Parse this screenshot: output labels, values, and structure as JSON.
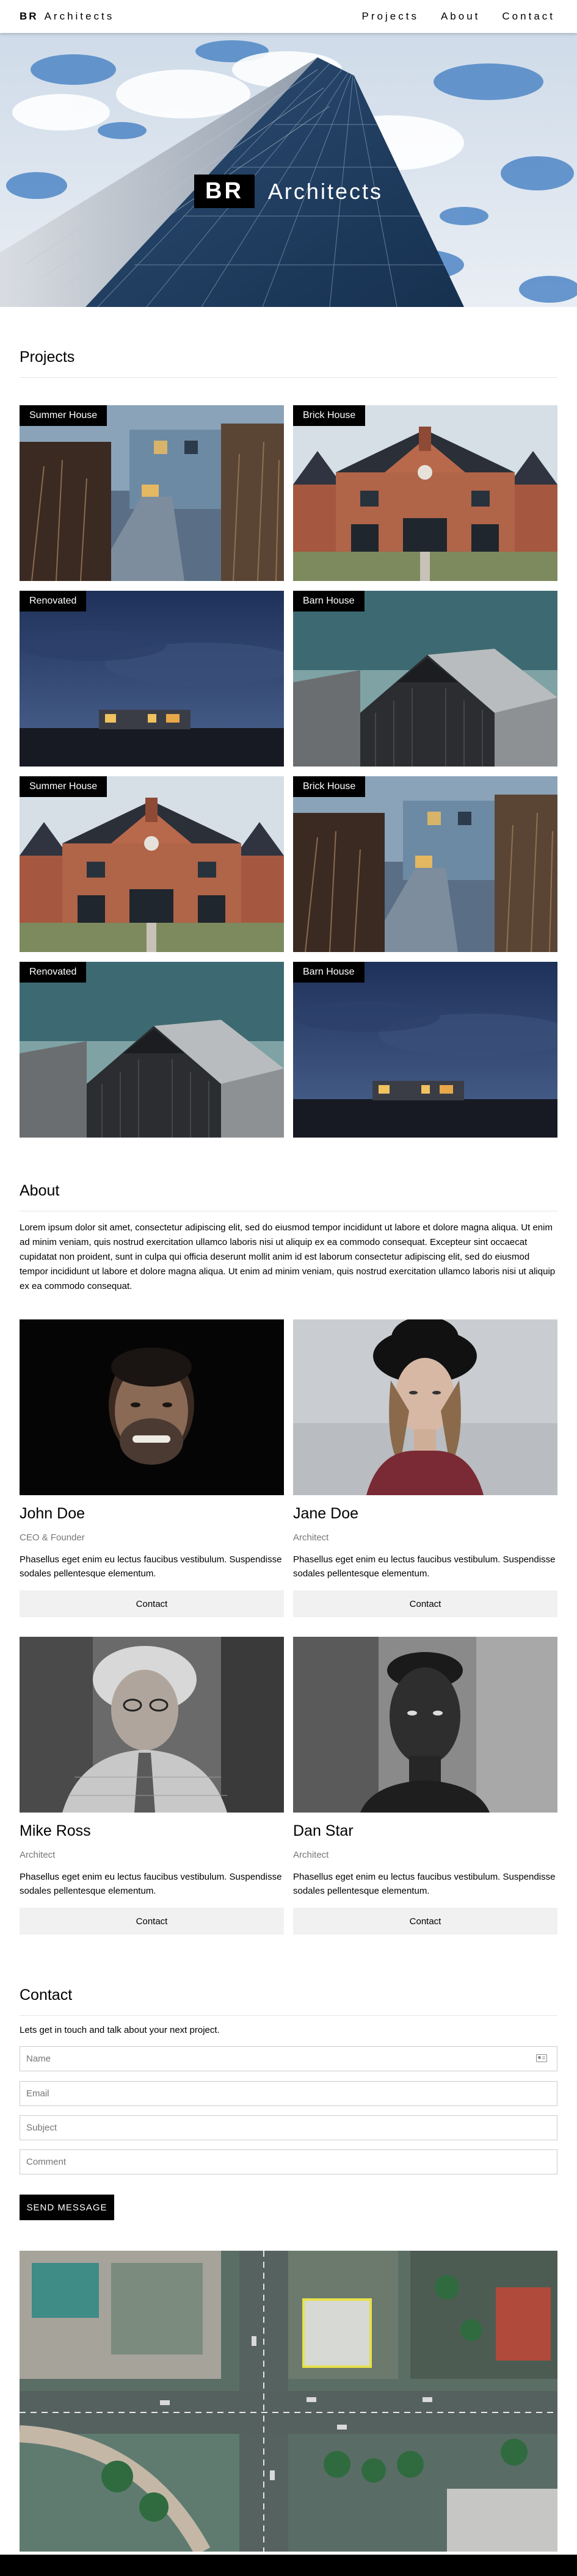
{
  "brand": {
    "bold": "BR",
    "name": "Architects"
  },
  "nav": [
    "Projects",
    "About",
    "Contact"
  ],
  "hero": {
    "bold": "BR",
    "name": "Architects"
  },
  "projects": {
    "title": "Projects",
    "items": [
      {
        "label": "Summer House"
      },
      {
        "label": "Brick House"
      },
      {
        "label": "Renovated"
      },
      {
        "label": "Barn House"
      },
      {
        "label": "Summer House"
      },
      {
        "label": "Brick House"
      },
      {
        "label": "Renovated"
      },
      {
        "label": "Barn House"
      }
    ]
  },
  "about": {
    "title": "About",
    "text": "Lorem ipsum dolor sit amet, consectetur adipiscing elit, sed do eiusmod tempor incididunt ut labore et dolore magna aliqua. Ut enim ad minim veniam, quis nostrud exercitation ullamco laboris nisi ut aliquip ex ea commodo consequat. Excepteur sint occaecat cupidatat non proident, sunt in culpa qui officia deserunt mollit anim id est laborum consectetur adipiscing elit, sed do eiusmod tempor incididunt ut labore et dolore magna aliqua. Ut enim ad minim veniam, quis nostrud exercitation ullamco laboris nisi ut aliquip ex ea commodo consequat."
  },
  "team": [
    {
      "name": "John Doe",
      "role": "CEO & Founder",
      "desc": "Phasellus eget enim eu lectus faucibus vestibulum. Suspendisse sodales pellentesque elementum.",
      "button": "Contact"
    },
    {
      "name": "Jane Doe",
      "role": "Architect",
      "desc": "Phasellus eget enim eu lectus faucibus vestibulum. Suspendisse sodales pellentesque elementum.",
      "button": "Contact"
    },
    {
      "name": "Mike Ross",
      "role": "Architect",
      "desc": "Phasellus eget enim eu lectus faucibus vestibulum. Suspendisse sodales pellentesque elementum.",
      "button": "Contact"
    },
    {
      "name": "Dan Star",
      "role": "Architect",
      "desc": "Phasellus eget enim eu lectus faucibus vestibulum. Suspendisse sodales pellentesque elementum.",
      "button": "Contact"
    }
  ],
  "contact": {
    "title": "Contact",
    "intro": "Lets get in touch and talk about your next project.",
    "fields": {
      "name": "Name",
      "email": "Email",
      "subject": "Subject",
      "comment": "Comment"
    },
    "send": "SEND MESSAGE"
  },
  "colors": {
    "primary": "#000000",
    "button_bg": "#f1f1f1",
    "muted": "#777777",
    "divider": "#e4e4e4"
  },
  "icons": {
    "name_field": "address-card-icon"
  }
}
